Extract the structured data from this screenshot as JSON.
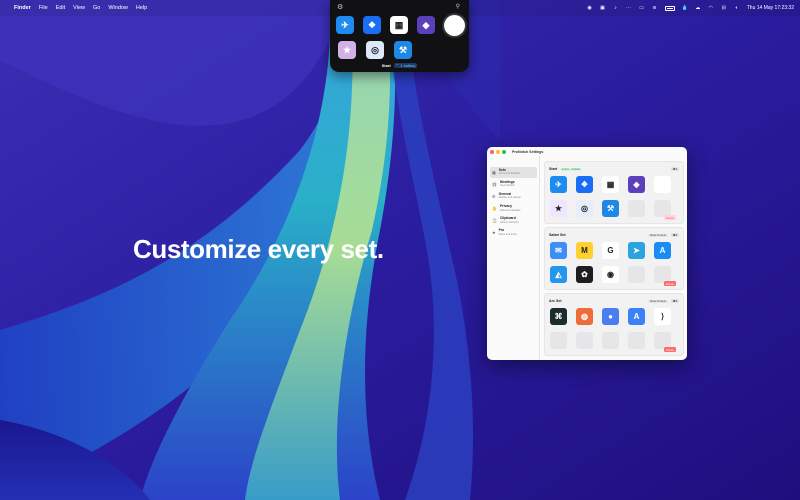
{
  "menubar": {
    "apple_icon": "apple-logo-icon",
    "app_name": "Finder",
    "menus": [
      "File",
      "Edit",
      "View",
      "Go",
      "Window",
      "Help"
    ],
    "status_text": "Thu 14 May  17:23:32",
    "status_icons": [
      "screen-record-icon",
      "camera-icon",
      "bell-icon",
      "dots-icon",
      "display-icon",
      "audio-icon",
      "battery-icon",
      "drop-icon",
      "cloud-icon",
      "wifi-icon",
      "control-center-icon",
      "siri-icon"
    ]
  },
  "headline": "Customize every set.",
  "popover": {
    "title": "Start",
    "tag": "⌃ 1 hotkey",
    "icons_row1": [
      {
        "name": "testflight-icon",
        "glyph": "✈",
        "color": "#1d8bf0"
      },
      {
        "name": "dropbox-icon",
        "glyph": "❖",
        "color": "#1a6ef5"
      },
      {
        "name": "calendar-icon",
        "glyph": "▦",
        "color": "#ffffff"
      },
      {
        "name": "notchnook-icon",
        "glyph": "◆",
        "color": "#5b3fbb"
      },
      {
        "name": "apple-icon",
        "glyph": "",
        "color": "#ffffff"
      }
    ],
    "icons_row2": [
      {
        "name": "starstruck-icon",
        "glyph": "★",
        "color": "#d3b1e6"
      },
      {
        "name": "safari-icon",
        "glyph": "◎",
        "color": "#dde9fa"
      },
      {
        "name": "xcode-icon",
        "glyph": "⚒",
        "color": "#1e88e5"
      }
    ]
  },
  "window": {
    "title": "ProNotch Settings",
    "sidebar": [
      {
        "title": "Sets",
        "subtitle": "Icons and defaults",
        "icon": "grid-icon",
        "active": true
      },
      {
        "title": "Bindings",
        "subtitle": "Keys binded",
        "icon": "link-icon",
        "active": false
      },
      {
        "title": "General",
        "subtitle": "Display and startup",
        "icon": "gear-icon",
        "active": false
      },
      {
        "title": "Privacy",
        "subtitle": "Data and updates",
        "icon": "hand-icon",
        "active": false
      },
      {
        "title": "Clipboard",
        "subtitle": "History behavior",
        "icon": "clipboard-icon",
        "active": false
      },
      {
        "title": "Pro",
        "subtitle": "Plans and limits",
        "icon": "star-icon",
        "active": false
      }
    ],
    "sets": [
      {
        "name": "Start",
        "badge": "Active · Default",
        "make_default": "",
        "shortcut": "⌘1",
        "delete_label": "Delete",
        "cells": [
          {
            "name": "testflight-icon",
            "glyph": "✈",
            "color": "#1d8bf0"
          },
          {
            "name": "dropbox-icon",
            "glyph": "❖",
            "color": "#1a6ef5"
          },
          {
            "name": "calendar-icon",
            "glyph": "▦",
            "color": "#ffffff"
          },
          {
            "name": "notchnook-icon",
            "glyph": "◆",
            "color": "#5b3fbb"
          },
          {
            "name": "apple-icon",
            "glyph": "",
            "color": "#ffffff"
          },
          {
            "name": "starstruck-icon",
            "glyph": "★",
            "color": "#f0e6ff"
          },
          {
            "name": "safari-icon",
            "glyph": "◎",
            "color": "#e6eefc"
          },
          {
            "name": "xcode-icon",
            "glyph": "⚒",
            "color": "#1e88e5"
          },
          {
            "name": "empty",
            "glyph": "",
            "color": ""
          },
          {
            "name": "empty",
            "glyph": "",
            "color": ""
          }
        ]
      },
      {
        "name": "Safari Set",
        "badge": "",
        "make_default": "Make Default",
        "shortcut": "⌘2",
        "delete_label": "Delete",
        "cells": [
          {
            "name": "mail-icon",
            "glyph": "✉",
            "color": "#3d8ef7"
          },
          {
            "name": "miro-icon",
            "glyph": "M",
            "color": "#ffd02f"
          },
          {
            "name": "google-icon",
            "glyph": "G",
            "color": "#ffffff"
          },
          {
            "name": "telegram-icon",
            "glyph": "➤",
            "color": "#2aa3e0"
          },
          {
            "name": "appstore-icon",
            "glyph": "A",
            "color": "#1a8cf5"
          },
          {
            "name": "docker-icon",
            "glyph": "◭",
            "color": "#2496ed"
          },
          {
            "name": "figma-icon",
            "glyph": "✿",
            "color": "#1e1e1e"
          },
          {
            "name": "chrome-icon",
            "glyph": "◉",
            "color": "#ffffff"
          },
          {
            "name": "empty",
            "glyph": "",
            "color": ""
          },
          {
            "name": "empty",
            "glyph": "",
            "color": ""
          }
        ]
      },
      {
        "name": "Arc Set",
        "badge": "",
        "make_default": "Make Default",
        "shortcut": "⌘3",
        "delete_label": "Delete",
        "cells": [
          {
            "name": "cursor-icon",
            "glyph": "⌘",
            "color": "#1c2b2b"
          },
          {
            "name": "basketball-icon",
            "glyph": "◍",
            "color": "#ee6c3a"
          },
          {
            "name": "webcam-icon",
            "glyph": "●",
            "color": "#4a7df0"
          },
          {
            "name": "instruments-icon",
            "glyph": "A",
            "color": "#3b82f6"
          },
          {
            "name": "vscode-icon",
            "glyph": "⟩",
            "color": "#ffffff"
          },
          {
            "name": "empty",
            "glyph": "",
            "color": ""
          },
          {
            "name": "empty",
            "glyph": "",
            "color": ""
          },
          {
            "name": "empty",
            "glyph": "",
            "color": ""
          },
          {
            "name": "empty",
            "glyph": "",
            "color": ""
          },
          {
            "name": "empty",
            "glyph": "",
            "color": ""
          }
        ]
      }
    ]
  }
}
